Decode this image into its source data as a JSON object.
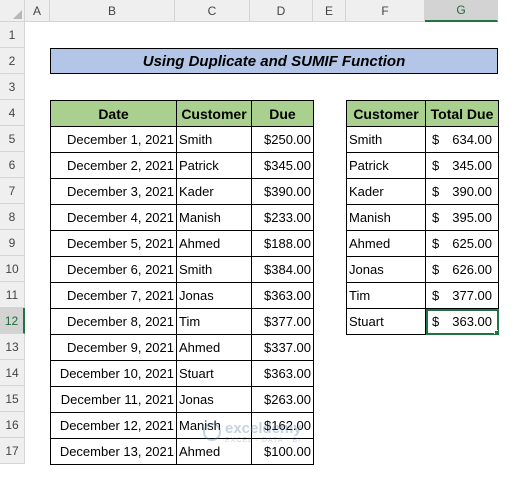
{
  "sheet": {
    "columns": [
      "A",
      "B",
      "C",
      "D",
      "E",
      "F",
      "G"
    ],
    "selected_column": "G",
    "rows": [
      "1",
      "2",
      "3",
      "4",
      "5",
      "6",
      "7",
      "8",
      "9",
      "10",
      "11",
      "12",
      "13",
      "14",
      "15",
      "16",
      "17"
    ],
    "selected_row": "12",
    "colors": {
      "header_fill": "#a9d08e",
      "title_fill": "#b4c6e7",
      "selection": "#217346"
    }
  },
  "title": "Using Duplicate and SUMIF Function",
  "left_table": {
    "headers": [
      "Date",
      "Customer",
      "Due"
    ],
    "rows": [
      [
        "December 1, 2021",
        "Smith",
        "$250.00"
      ],
      [
        "December 2, 2021",
        "Patrick",
        "$345.00"
      ],
      [
        "December 3, 2021",
        "Kader",
        "$390.00"
      ],
      [
        "December 4, 2021",
        "Manish",
        "$233.00"
      ],
      [
        "December 5, 2021",
        "Ahmed",
        "$188.00"
      ],
      [
        "December 6, 2021",
        "Smith",
        "$384.00"
      ],
      [
        "December 7, 2021",
        "Jonas",
        "$363.00"
      ],
      [
        "December 8, 2021",
        "Tim",
        "$377.00"
      ],
      [
        "December 9, 2021",
        "Ahmed",
        "$337.00"
      ],
      [
        "December 10, 2021",
        "Stuart",
        "$363.00"
      ],
      [
        "December 11, 2021",
        "Jonas",
        "$263.00"
      ],
      [
        "December 12, 2021",
        "Manish",
        "$162.00"
      ],
      [
        "December 13, 2021",
        "Ahmed",
        "$100.00"
      ]
    ]
  },
  "right_table": {
    "headers": [
      "Customer",
      "Total Due"
    ],
    "currency": "$",
    "rows": [
      [
        "Smith",
        "634.00"
      ],
      [
        "Patrick",
        "345.00"
      ],
      [
        "Kader",
        "390.00"
      ],
      [
        "Manish",
        "395.00"
      ],
      [
        "Ahmed",
        "625.00"
      ],
      [
        "Jonas",
        "626.00"
      ],
      [
        "Tim",
        "377.00"
      ],
      [
        "Stuart",
        "363.00"
      ]
    ]
  },
  "watermark": {
    "name": "exceldemy",
    "tagline": "EXCEL · DATA · BI"
  }
}
